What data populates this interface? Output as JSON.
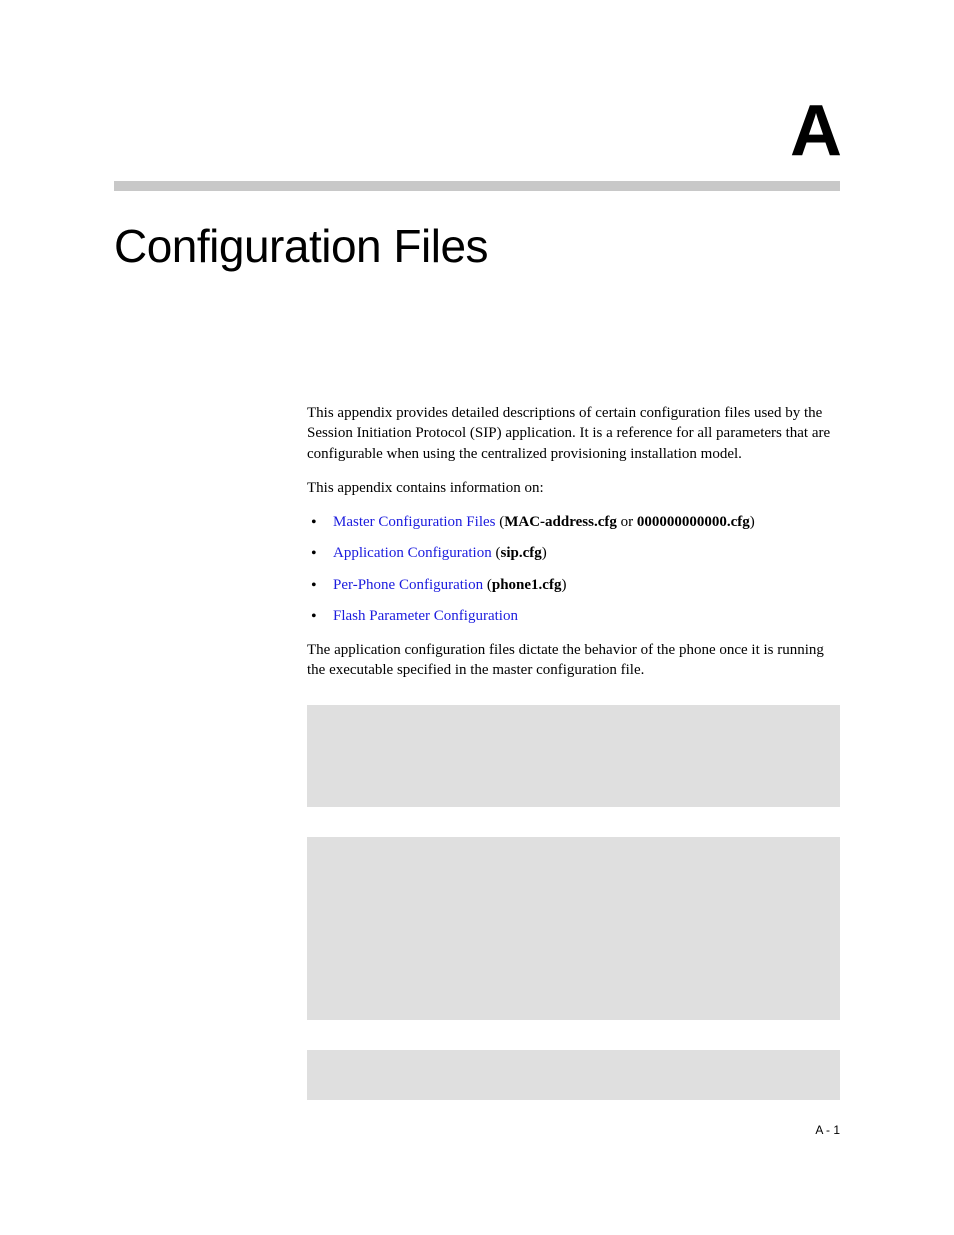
{
  "appendix": {
    "letter": "A"
  },
  "chapter": {
    "title": "Configuration Files"
  },
  "content": {
    "intro": "This appendix provides detailed descriptions of certain configuration files used by the Session Initiation Protocol (SIP) application. It is a reference for all parameters that are configurable when using the centralized provisioning installation model.",
    "lead_in": "This appendix contains information on:",
    "bullets": [
      {
        "link_text": "Master Configuration Files",
        "suffix_pre": " (",
        "bold1": "MAC-address.cfg",
        "mid": " or ",
        "bold2": "000000000000.cfg",
        "suffix_post": ")"
      },
      {
        "link_text": "Application Configuration",
        "suffix_pre": " (",
        "bold1": "sip.cfg",
        "mid": "",
        "bold2": "",
        "suffix_post": ")"
      },
      {
        "link_text": "Per-Phone Configuration",
        "suffix_pre": " (",
        "bold1": "phone1.cfg",
        "mid": "",
        "bold2": "",
        "suffix_post": ")"
      },
      {
        "link_text": "Flash Parameter Configuration",
        "suffix_pre": "",
        "bold1": "",
        "mid": "",
        "bold2": "",
        "suffix_post": ""
      }
    ],
    "tail": "The application configuration files dictate the behavior of the phone once it is running the executable specified in the master configuration file."
  },
  "footer": {
    "page_number": "A - 1"
  }
}
